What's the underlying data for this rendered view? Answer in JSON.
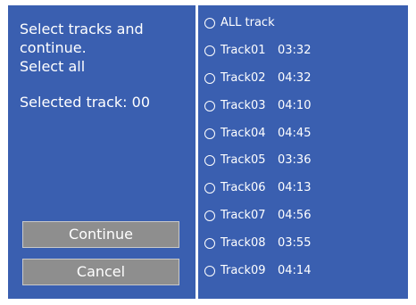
{
  "left_panel": {
    "instruction_lines": [
      "Select tracks and",
      "continue.",
      "Select all"
    ],
    "selected_label": "Selected track: 00"
  },
  "buttons": {
    "continue": "Continue",
    "cancel": "Cancel"
  },
  "tracks": [
    {
      "name": "ALL track",
      "time": ""
    },
    {
      "name": "Track01",
      "time": "03:32"
    },
    {
      "name": "Track02",
      "time": "04:32"
    },
    {
      "name": "Track03",
      "time": "04:10"
    },
    {
      "name": "Track04",
      "time": "04:45"
    },
    {
      "name": "Track05",
      "time": "03:36"
    },
    {
      "name": "Track06",
      "time": "04:13"
    },
    {
      "name": "Track07",
      "time": "04:56"
    },
    {
      "name": "Track08",
      "time": "03:55"
    },
    {
      "name": "Track09",
      "time": "04:14"
    }
  ],
  "colors": {
    "background": "#3a5fb0",
    "button": "#8e8e8e",
    "text": "#ffffff"
  }
}
